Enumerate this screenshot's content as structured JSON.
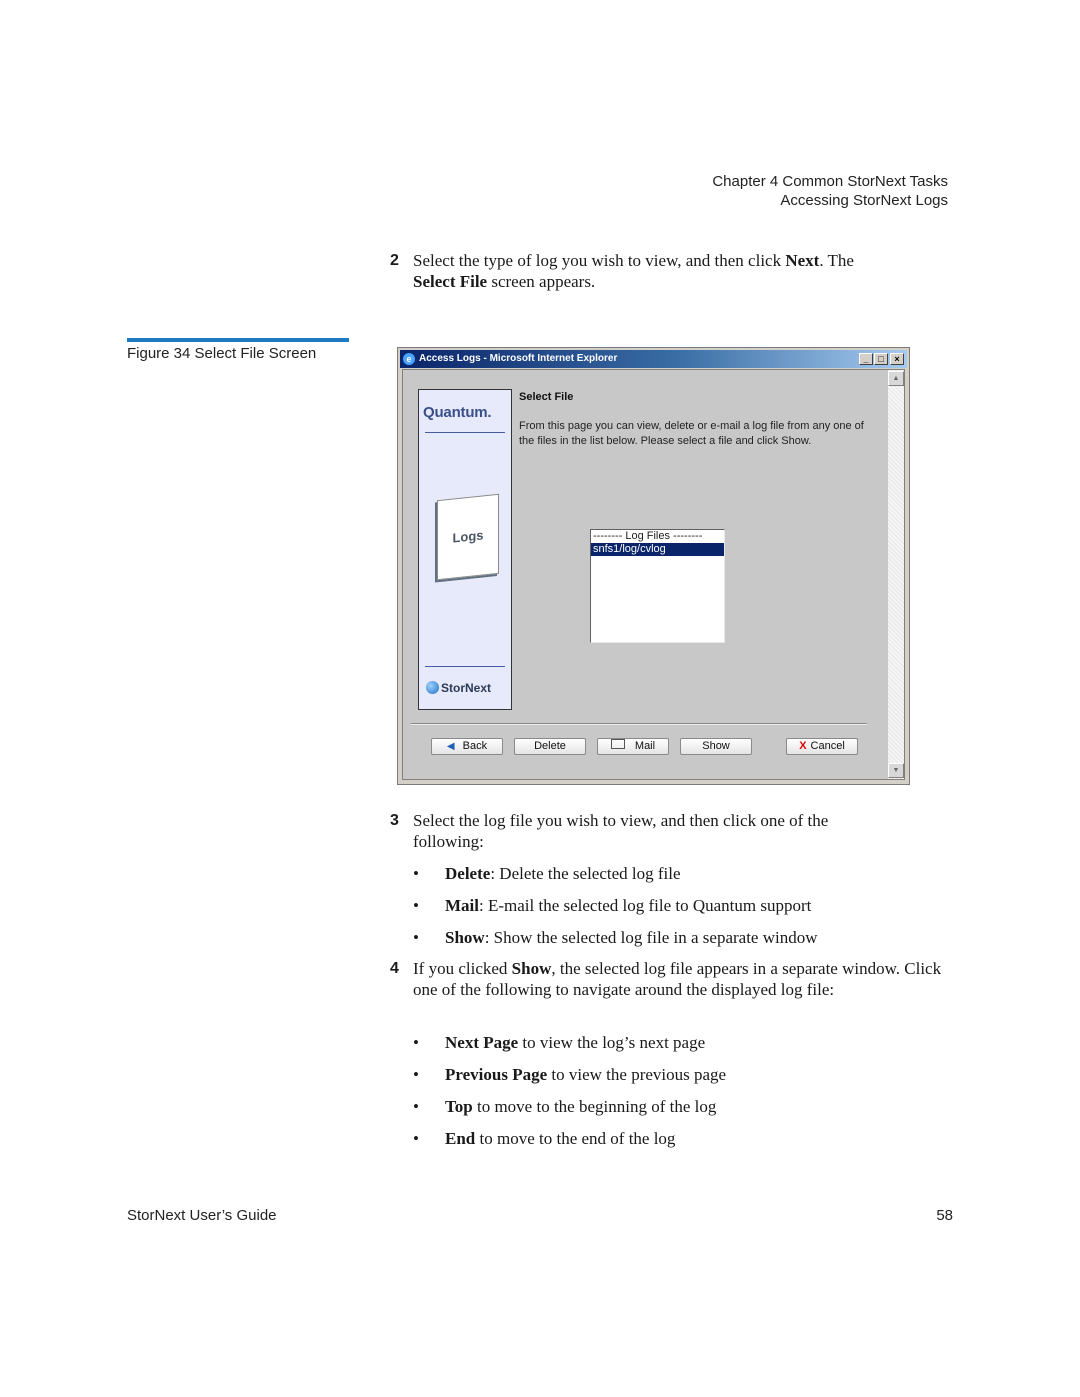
{
  "header": {
    "chapter": "Chapter 4  Common StorNext Tasks",
    "section": "Accessing StorNext Logs"
  },
  "step2": {
    "number": "2",
    "text_a": "Select the type of log you wish to view, and then click ",
    "bold_a": "Next",
    "text_b": ". The ",
    "bold_b": "Select File",
    "text_c": " screen appears."
  },
  "figure": {
    "caption": "Figure 34  Select File Screen"
  },
  "window": {
    "title": "Access Logs - Microsoft Internet Explorer",
    "controls": {
      "minimize": "_",
      "maximize": "□",
      "close": "×"
    },
    "sidebar": {
      "quantum_logo": "Quantum.",
      "logs_card": "Logs",
      "stornext_logo": "StorNext"
    },
    "content": {
      "title": "Select File",
      "description": "From this page you can view, delete or e-mail a log file from any one of the files in the list below. Please select a file and click Show."
    },
    "listbox": {
      "items": [
        "-------- Log Files --------",
        "snfs1/log/cvlog"
      ],
      "selected": "snfs1/log/cvlog"
    },
    "buttons": {
      "back": "Back",
      "delete": "Delete",
      "mail": "Mail",
      "show": "Show",
      "cancel": "Cancel"
    },
    "scrollbar": {
      "up": "▲",
      "down": "▼"
    }
  },
  "step3": {
    "number": "3",
    "text": "Select the log file you wish to view, and then click one of the following:",
    "bullets": [
      {
        "bold": "Delete",
        "text": ": Delete the selected log file"
      },
      {
        "bold": "Mail",
        "text": ": E-mail the selected log file to Quantum support"
      },
      {
        "bold": "Show",
        "text": ": Show the selected log file in a separate window"
      }
    ]
  },
  "step4": {
    "number": "4",
    "text_a": "If you clicked ",
    "bold_a": "Show",
    "text_b": ", the selected log file appears in a separate window. Click one of the following to navigate around the displayed log file:",
    "bullets": [
      {
        "bold": "Next Page",
        "text": " to view the log’s next page"
      },
      {
        "bold": "Previous Page",
        "text": " to view the previous page"
      },
      {
        "bold": "Top",
        "text": " to move to the beginning of the log"
      },
      {
        "bold": "End",
        "text": " to move to the end of the log"
      }
    ]
  },
  "footer": {
    "guide": "StorNext User’s Guide",
    "page": "58"
  },
  "bullet_char": "•"
}
